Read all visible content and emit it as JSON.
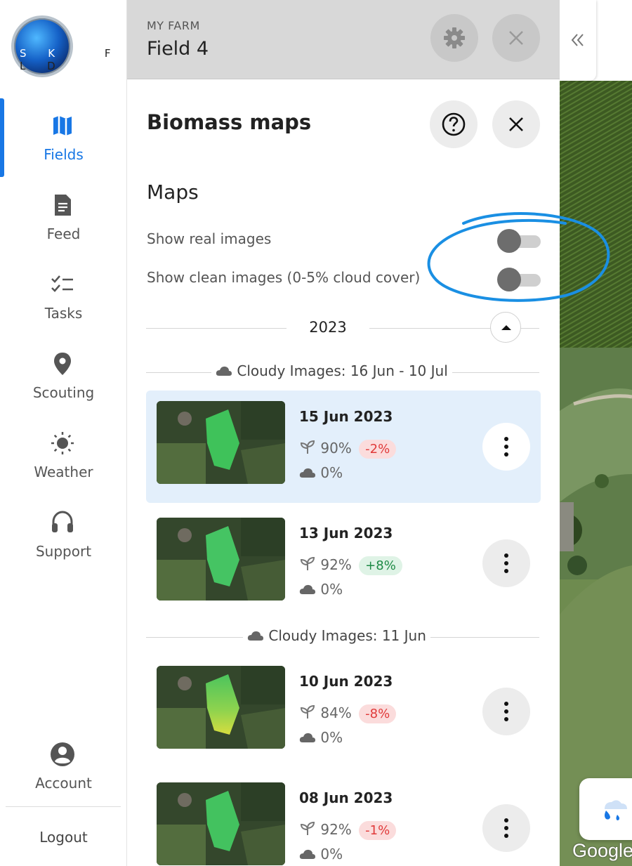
{
  "logo": {
    "letters_inside": "S K Y",
    "letters_outside": "F L D"
  },
  "sidebar": {
    "items": [
      {
        "label": "Fields",
        "icon": "map-icon",
        "active": true
      },
      {
        "label": "Feed",
        "icon": "document-icon",
        "active": false
      },
      {
        "label": "Tasks",
        "icon": "checklist-icon",
        "active": false
      },
      {
        "label": "Scouting",
        "icon": "location-pin-icon",
        "active": false
      },
      {
        "label": "Weather",
        "icon": "sun-icon",
        "active": false
      },
      {
        "label": "Support",
        "icon": "headset-icon",
        "active": false
      }
    ],
    "account": {
      "label": "Account",
      "icon": "user-circle-icon"
    },
    "logout": "Logout"
  },
  "header": {
    "farm": "MY FARM",
    "field": "Field 4",
    "settings_icon": "gear-icon",
    "close_icon": "close-icon",
    "collapse_icon": "double-chevron-left-icon"
  },
  "panel": {
    "title": "Biomass maps",
    "help_icon": "help-circle-icon",
    "close_icon": "close-icon",
    "maps_heading": "Maps",
    "toggles": [
      {
        "label": "Show real images",
        "on": false
      },
      {
        "label": "Show clean images (0-5% cloud cover)",
        "on": false
      }
    ],
    "year": "2023",
    "groups": [
      {
        "label": "Cloudy Images: 16 Jun - 10 Jul",
        "items": [
          {
            "date": "15 Jun 2023",
            "biomass": "90%",
            "change": "-2%",
            "trend": "neg",
            "cloud": "0%",
            "selected": true
          },
          {
            "date": "13 Jun 2023",
            "biomass": "92%",
            "change": "+8%",
            "trend": "pos",
            "cloud": "0%",
            "selected": false
          }
        ]
      },
      {
        "label": "Cloudy Images: 11 Jun",
        "items": [
          {
            "date": "10 Jun 2023",
            "biomass": "84%",
            "change": "-8%",
            "trend": "neg",
            "cloud": "0%",
            "selected": false
          },
          {
            "date": "08 Jun 2023",
            "biomass": "92%",
            "change": "-1%",
            "trend": "neg",
            "cloud": "0%",
            "selected": false
          }
        ]
      }
    ]
  },
  "map": {
    "attribution": "Google",
    "weather_icon": "rain-cloud-icon"
  },
  "colors": {
    "accent": "#1877e5",
    "selected_bg": "#e3effb",
    "negative": "#e03a3a",
    "positive": "#1e8a45"
  }
}
